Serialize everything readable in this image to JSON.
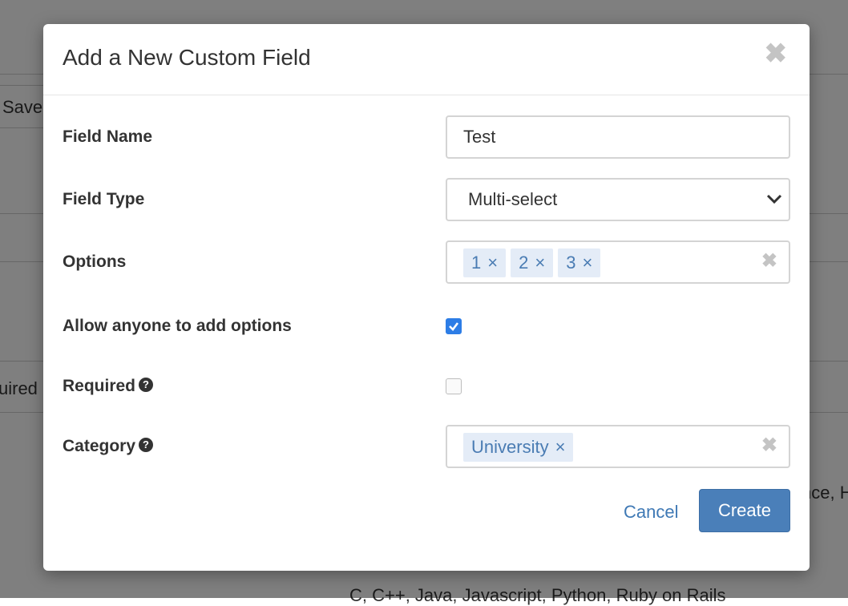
{
  "background": {
    "save_button_label": "Save",
    "required_fragment": "uired",
    "skills_fragment": "C, C++, Java, Javascript, Python, Ruby on Rails",
    "right_fragment": "nce, H"
  },
  "modal": {
    "title": "Add a New Custom Field",
    "close_icon": "close-icon",
    "fields": {
      "field_name": {
        "label": "Field Name",
        "value": "Test"
      },
      "field_type": {
        "label": "Field Type",
        "value": "Multi-select"
      },
      "options": {
        "label": "Options",
        "tags": [
          "1",
          "2",
          "3"
        ],
        "tag_remove_glyph": "×",
        "clear_glyph": "✖"
      },
      "allow_add": {
        "label": "Allow anyone to add options",
        "checked": true
      },
      "required": {
        "label": "Required",
        "help_icon": "question-circle-icon",
        "checked": false
      },
      "category": {
        "label": "Category",
        "help_icon": "question-circle-icon",
        "tags": [
          "University"
        ],
        "tag_remove_glyph": "×",
        "clear_glyph": "✖"
      }
    },
    "footer": {
      "cancel_label": "Cancel",
      "create_label": "Create"
    }
  },
  "colors": {
    "accent": "#4a7fb9",
    "link": "#3f79b5",
    "tag_bg": "#e4ecf7",
    "tag_text": "#4a7cb3",
    "checkbox_checked": "#2d7de6"
  }
}
